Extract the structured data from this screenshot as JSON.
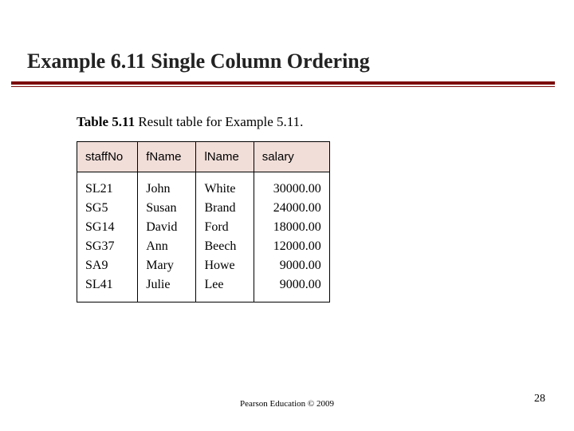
{
  "title": "Example 6.11  Single Column Ordering",
  "table": {
    "label_strong": "Table 5.11",
    "label_rest": "   Result table for Example 5.11.",
    "headers": [
      "staffNo",
      "fName",
      "lName",
      "salary"
    ],
    "rows": [
      {
        "staffNo": "SL21",
        "fName": "John",
        "lName": "White",
        "salary": "30000.00"
      },
      {
        "staffNo": "SG5",
        "fName": "Susan",
        "lName": "Brand",
        "salary": "24000.00"
      },
      {
        "staffNo": "SG14",
        "fName": "David",
        "lName": "Ford",
        "salary": "18000.00"
      },
      {
        "staffNo": "SG37",
        "fName": "Ann",
        "lName": "Beech",
        "salary": "12000.00"
      },
      {
        "staffNo": "SA9",
        "fName": "Mary",
        "lName": "Howe",
        "salary": "9000.00"
      },
      {
        "staffNo": "SL41",
        "fName": "Julie",
        "lName": "Lee",
        "salary": "9000.00"
      }
    ]
  },
  "footer": "Pearson Education © 2009",
  "page_number": "28",
  "chart_data": {
    "type": "table",
    "title": "Table 5.11 — Result table for Example 5.11.",
    "columns": [
      "staffNo",
      "fName",
      "lName",
      "salary"
    ],
    "rows": [
      [
        "SL21",
        "John",
        "White",
        30000.0
      ],
      [
        "SG5",
        "Susan",
        "Brand",
        24000.0
      ],
      [
        "SG14",
        "David",
        "Ford",
        18000.0
      ],
      [
        "SG37",
        "Ann",
        "Beech",
        12000.0
      ],
      [
        "SA9",
        "Mary",
        "Howe",
        9000.0
      ],
      [
        "SL41",
        "Julie",
        "Lee",
        9000.0
      ]
    ]
  }
}
